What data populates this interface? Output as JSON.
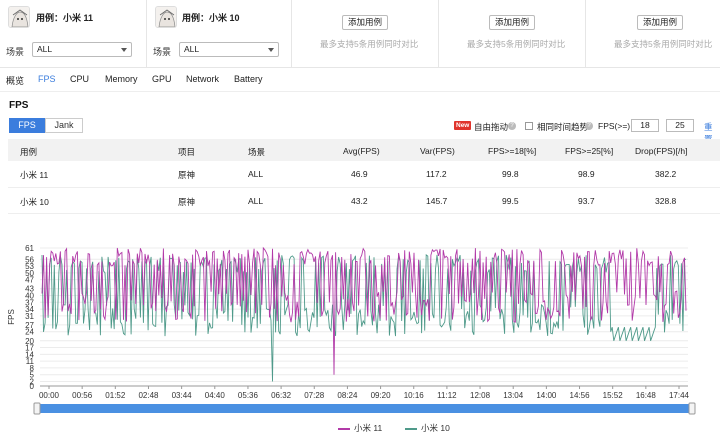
{
  "devices": [
    {
      "name": "用例：小米 11",
      "scene_label": "场景",
      "scene_value": "ALL"
    },
    {
      "name": "用例：小米 10",
      "scene_label": "场景",
      "scene_value": "ALL"
    }
  ],
  "add_slots": [
    {
      "button": "添加用例",
      "hint": "最多支持5条用例同时对比"
    },
    {
      "button": "添加用例",
      "hint": "最多支持5条用例同时对比"
    },
    {
      "button": "添加用例",
      "hint": "最多支持5条用例同时对比"
    }
  ],
  "tabs": [
    "概览",
    "FPS",
    "CPU",
    "Memory",
    "GPU",
    "Network",
    "Battery"
  ],
  "active_tab": "FPS",
  "section_title": "FPS",
  "segments": [
    "FPS",
    "Jank"
  ],
  "controls": {
    "new_badge": "New",
    "free_drag": "自由拖动",
    "same_time_trend": "相同时间趋势",
    "fps_ge_label": "FPS(>=)",
    "fps_ge_1": "18",
    "fps_ge_2": "25",
    "reset": "重置"
  },
  "table": {
    "headers": [
      "用例",
      "项目",
      "场景",
      "Avg(FPS)",
      "Var(FPS)",
      "FPS>=18[%]",
      "FPS>=25[%]",
      "Drop(FPS)[/h]"
    ],
    "rows": [
      [
        "小米 11",
        "原神",
        "ALL",
        "46.9",
        "117.2",
        "99.8",
        "98.9",
        "382.2"
      ],
      [
        "小米 10",
        "原神",
        "ALL",
        "43.2",
        "145.7",
        "99.5",
        "93.7",
        "328.8"
      ]
    ]
  },
  "colors": {
    "accent": "#3b7ddd",
    "series_mi11": "#b23aa8",
    "series_mi10": "#4f9a8a"
  },
  "chart_data": {
    "type": "line",
    "ylabel": "FPS",
    "xlabel": "",
    "ylim": [
      0,
      61
    ],
    "yticks": [
      0,
      2,
      5,
      8,
      11,
      14,
      17,
      20,
      24,
      27,
      31,
      34,
      37,
      40,
      43,
      47,
      50,
      53,
      56,
      61
    ],
    "xticks": [
      "00:00",
      "00:56",
      "01:52",
      "02:48",
      "03:44",
      "04:40",
      "05:36",
      "06:32",
      "07:28",
      "08:24",
      "09:20",
      "10:16",
      "11:12",
      "12:08",
      "13:04",
      "14:00",
      "14:56",
      "15:52",
      "16:48",
      "17:44"
    ],
    "grid": true,
    "legend_position": "bottom",
    "series": [
      {
        "name": "小米 11",
        "color": "#b23aa8"
      },
      {
        "name": "小米 10",
        "color": "#4f9a8a"
      }
    ]
  },
  "icons": {
    "help": "question-circle-icon",
    "chevron": "chevron-down-icon",
    "avatar": "anime-avatar-icon"
  }
}
